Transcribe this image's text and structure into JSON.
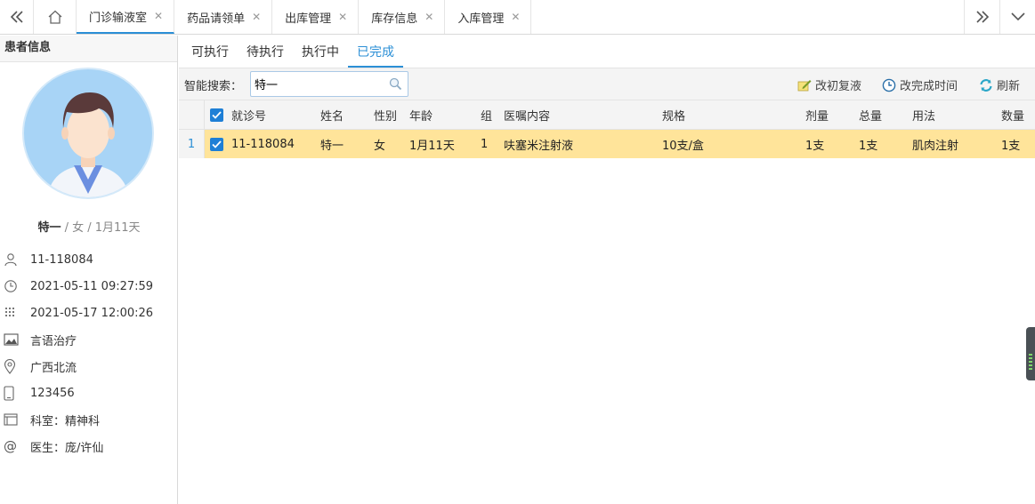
{
  "topbar": {
    "tabs": [
      {
        "label": "门诊输液室",
        "active": true
      },
      {
        "label": "药品请领单",
        "active": false
      },
      {
        "label": "出库管理",
        "active": false
      },
      {
        "label": "库存信息",
        "active": false
      },
      {
        "label": "入库管理",
        "active": false
      }
    ]
  },
  "patient": {
    "panel_title": "患者信息",
    "name": "特一",
    "summary_rest": " / 女 / 1月11天",
    "id": "11-118084",
    "time1": "2021-05-11 09:27:59",
    "time2": "2021-05-17 12:00:26",
    "treatment": "言语治疗",
    "location": "广西北流",
    "phone": "123456",
    "dept": "科室：精神科",
    "doctor": "医生：庞/许仙"
  },
  "subtabs": [
    "可执行",
    "待执行",
    "执行中",
    "已完成"
  ],
  "toolbar": {
    "search_label": "智能搜索：",
    "search_value": "特一",
    "btn_recheck": "改初复液",
    "btn_time": "改完成时间",
    "btn_refresh": "刷新"
  },
  "grid": {
    "headers": {
      "visit_no": "就诊号",
      "name": "姓名",
      "sex": "性别",
      "age": "年龄",
      "group": "组",
      "order": "医嘱内容",
      "spec": "规格",
      "dose": "剂量",
      "total": "总量",
      "usage": "用法",
      "qty": "数量"
    },
    "rows": [
      {
        "num": "1",
        "visit_no": "11-118084",
        "name": "特一",
        "sex": "女",
        "age": "1月11天",
        "group": "1",
        "order": "呋塞米注射液",
        "spec": "10支/盒",
        "dose": "1支",
        "total": "1支",
        "usage": "肌肉注射",
        "qty": "1支"
      }
    ]
  },
  "colors": {
    "accent": "#2b8fd6",
    "row_highlight": "#ffe49a",
    "avatar_bg": "#a8d4f6"
  }
}
